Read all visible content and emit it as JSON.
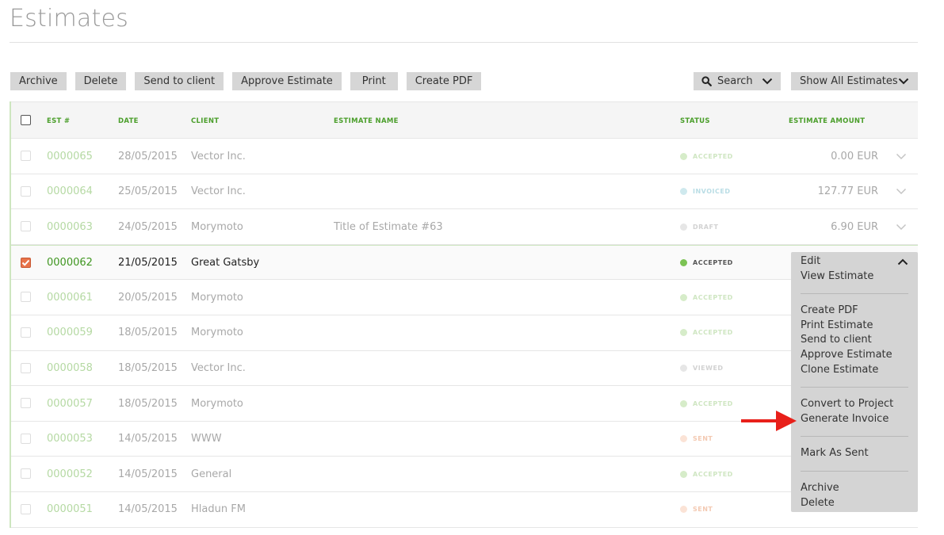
{
  "page": {
    "title": "Estimates"
  },
  "toolbar": {
    "archive": "Archive",
    "delete": "Delete",
    "send_to_client": "Send to client",
    "approve_estimate": "Approve Estimate",
    "print": "Print",
    "create_pdf": "Create PDF",
    "search": "Search",
    "show_filter": "Show All Estimates"
  },
  "table": {
    "headers": {
      "est": "EST #",
      "date": "DATE",
      "client": "CLIENT",
      "name": "ESTIMATE NAME",
      "status": "STATUS",
      "amount": "ESTIMATE AMOUNT"
    },
    "rows": [
      {
        "est": "0000065",
        "date": "28/05/2015",
        "client": "Vector Inc.",
        "name": "",
        "status": "ACCEPTED",
        "status_color": "#d6ecc9",
        "amount": "0.00 EUR"
      },
      {
        "est": "0000064",
        "date": "25/05/2015",
        "client": "Vector Inc.",
        "name": "",
        "status": "INVOICED",
        "status_color": "#cfe9ee",
        "amount": "127.77 EUR"
      },
      {
        "est": "0000063",
        "date": "24/05/2015",
        "client": "Morymoto",
        "name": "Title of Estimate #63",
        "status": "DRAFT",
        "status_color": "#e6e6e6",
        "amount": "6.90 EUR"
      },
      {
        "est": "0000062",
        "date": "21/05/2015",
        "client": "Great Gatsby",
        "name": "",
        "status": "ACCEPTED",
        "status_color": "#7cc354",
        "amount": ""
      },
      {
        "est": "0000061",
        "date": "20/05/2015",
        "client": "Morymoto",
        "name": "",
        "status": "ACCEPTED",
        "status_color": "#d6ecc9",
        "amount": ""
      },
      {
        "est": "0000059",
        "date": "18/05/2015",
        "client": "Morymoto",
        "name": "",
        "status": "ACCEPTED",
        "status_color": "#d6ecc9",
        "amount": ""
      },
      {
        "est": "0000058",
        "date": "18/05/2015",
        "client": "Vector Inc.",
        "name": "",
        "status": "VIEWED",
        "status_color": "#e6e6e6",
        "amount": ""
      },
      {
        "est": "0000057",
        "date": "18/05/2015",
        "client": "Morymoto",
        "name": "",
        "status": "ACCEPTED",
        "status_color": "#d6ecc9",
        "amount": ""
      },
      {
        "est": "0000053",
        "date": "14/05/2015",
        "client": "WWW",
        "name": "",
        "status": "SENT",
        "status_color": "#fbe3d6",
        "amount": ""
      },
      {
        "est": "0000052",
        "date": "14/05/2015",
        "client": "General",
        "name": "",
        "status": "ACCEPTED",
        "status_color": "#d6ecc9",
        "amount": ""
      },
      {
        "est": "0000051",
        "date": "14/05/2015",
        "client": "Hladun FM",
        "name": "",
        "status": "SENT",
        "status_color": "#fbe3d6",
        "amount": ""
      }
    ]
  },
  "menu": {
    "edit": "Edit",
    "view": "View Estimate",
    "create_pdf": "Create PDF",
    "print": "Print Estimate",
    "send": "Send to client",
    "approve": "Approve Estimate",
    "clone": "Clone Estimate",
    "convert": "Convert to Project",
    "generate_invoice": "Generate Invoice",
    "mark_sent": "Mark As Sent",
    "archive": "Archive",
    "delete": "Delete"
  },
  "colors": {
    "accent_green": "#4a9e2a",
    "arrow": "#e8201a",
    "checked": "#e8734a"
  }
}
